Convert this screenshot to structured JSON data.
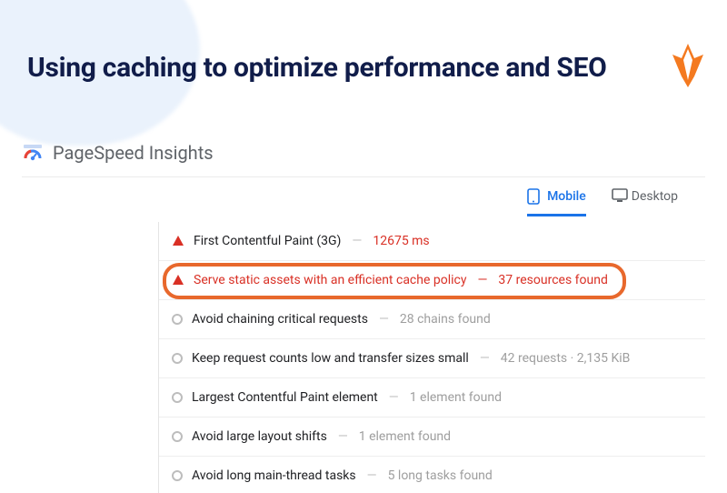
{
  "header": {
    "title": "Using caching to optimize performance and SEO"
  },
  "tool": {
    "name": "PageSpeed Insights"
  },
  "tabs": {
    "mobile": "Mobile",
    "desktop": "Desktop",
    "active": "mobile"
  },
  "audits": [
    {
      "status": "fail",
      "label": "First Contentful Paint (3G)",
      "detail": "12675 ms",
      "highlight": false
    },
    {
      "status": "fail",
      "label": "Serve static assets with an efficient cache policy",
      "detail": "37 resources found",
      "highlight": true
    },
    {
      "status": "neutral",
      "label": "Avoid chaining critical requests",
      "detail": "28 chains found",
      "highlight": false
    },
    {
      "status": "neutral",
      "label": "Keep request counts low and transfer sizes small",
      "detail": "42 requests · 2,135 KiB",
      "highlight": false
    },
    {
      "status": "neutral",
      "label": "Largest Contentful Paint element",
      "detail": "1 element found",
      "highlight": false
    },
    {
      "status": "neutral",
      "label": "Avoid large layout shifts",
      "detail": "1 element found",
      "highlight": false
    },
    {
      "status": "neutral",
      "label": "Avoid long main-thread tasks",
      "detail": "5 long tasks found",
      "highlight": false
    }
  ],
  "colors": {
    "heading": "#111d4a",
    "fail": "#d93025",
    "highlight_border": "#e8682c",
    "brand_blue": "#1a73e8"
  }
}
